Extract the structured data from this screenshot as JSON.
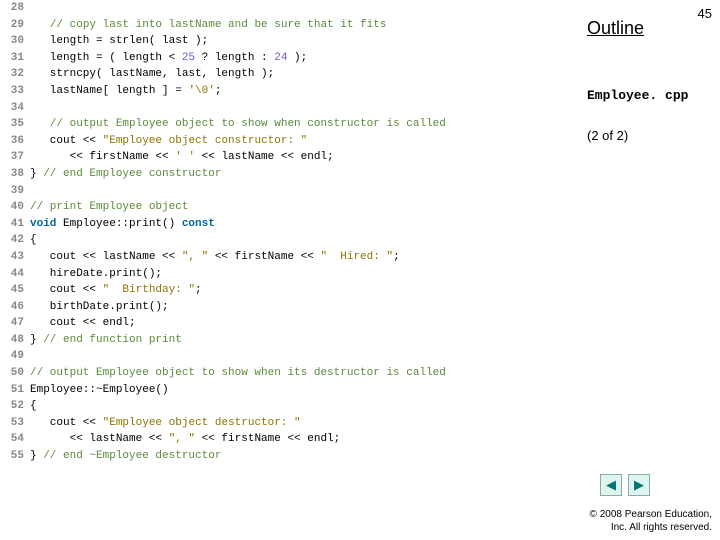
{
  "page_number": "45",
  "outline_label": "Outline",
  "filename": "Employee. cpp",
  "part_info": "(2 of 2)",
  "copyright_line1": "© 2008 Pearson Education,",
  "copyright_line2": "Inc.  All rights reserved.",
  "nav": {
    "prev_glyph": "◀",
    "next_glyph": "▶"
  },
  "code": [
    {
      "n": "28",
      "t": []
    },
    {
      "n": "29",
      "t": [
        [
          "   ",
          "p"
        ],
        [
          "// copy last into lastName and be sure that it fits",
          "comment"
        ]
      ]
    },
    {
      "n": "30",
      "t": [
        [
          "   length = strlen( last );",
          "p"
        ]
      ]
    },
    {
      "n": "31",
      "t": [
        [
          "   length = ( length < ",
          "p"
        ],
        [
          "25",
          "num"
        ],
        [
          " ? length : ",
          "p"
        ],
        [
          "24",
          "num"
        ],
        [
          " );",
          "p"
        ]
      ]
    },
    {
      "n": "32",
      "t": [
        [
          "   strncpy( lastName, last, length );",
          "p"
        ]
      ]
    },
    {
      "n": "33",
      "t": [
        [
          "   lastName[ length ] = ",
          "p"
        ],
        [
          "'\\0'",
          "char"
        ],
        [
          ";",
          "p"
        ]
      ]
    },
    {
      "n": "34",
      "t": []
    },
    {
      "n": "35",
      "t": [
        [
          "   ",
          "p"
        ],
        [
          "// output Employee object to show when constructor is called",
          "comment"
        ]
      ]
    },
    {
      "n": "36",
      "t": [
        [
          "   cout << ",
          "p"
        ],
        [
          "\"Employee object constructor: \"",
          "str"
        ]
      ]
    },
    {
      "n": "37",
      "t": [
        [
          "      << firstName << ",
          "p"
        ],
        [
          "' '",
          "char"
        ],
        [
          " << lastName << endl;",
          "p"
        ]
      ]
    },
    {
      "n": "38",
      "t": [
        [
          "} ",
          "p"
        ],
        [
          "// end Employee constructor",
          "comment"
        ]
      ]
    },
    {
      "n": "39",
      "t": []
    },
    {
      "n": "40",
      "t": [
        [
          "// print Employee object",
          "comment"
        ]
      ]
    },
    {
      "n": "41",
      "t": [
        [
          "void",
          "kw"
        ],
        [
          " Employee::print() ",
          "p"
        ],
        [
          "const",
          "kw"
        ]
      ]
    },
    {
      "n": "42",
      "t": [
        [
          "{",
          "p"
        ]
      ]
    },
    {
      "n": "43",
      "t": [
        [
          "   cout << lastName << ",
          "p"
        ],
        [
          "\", \"",
          "str"
        ],
        [
          " << firstName << ",
          "p"
        ],
        [
          "\"  Hired: \"",
          "str"
        ],
        [
          ";",
          "p"
        ]
      ]
    },
    {
      "n": "44",
      "t": [
        [
          "   hireDate.print();",
          "p"
        ]
      ]
    },
    {
      "n": "45",
      "t": [
        [
          "   cout << ",
          "p"
        ],
        [
          "\"  Birthday: \"",
          "str"
        ],
        [
          ";",
          "p"
        ]
      ]
    },
    {
      "n": "46",
      "t": [
        [
          "   birthDate.print();",
          "p"
        ]
      ]
    },
    {
      "n": "47",
      "t": [
        [
          "   cout << endl;",
          "p"
        ]
      ]
    },
    {
      "n": "48",
      "t": [
        [
          "} ",
          "p"
        ],
        [
          "// end function print",
          "comment"
        ]
      ]
    },
    {
      "n": "49",
      "t": []
    },
    {
      "n": "50",
      "t": [
        [
          "// output Employee object to show when its destructor is called",
          "comment"
        ]
      ]
    },
    {
      "n": "51",
      "t": [
        [
          "Employee::~Employee()",
          "p"
        ]
      ]
    },
    {
      "n": "52",
      "t": [
        [
          "{",
          "p"
        ]
      ]
    },
    {
      "n": "53",
      "t": [
        [
          "   cout << ",
          "p"
        ],
        [
          "\"Employee object destructor: \"",
          "str"
        ]
      ]
    },
    {
      "n": "54",
      "t": [
        [
          "      << lastName << ",
          "p"
        ],
        [
          "\", \"",
          "str"
        ],
        [
          " << firstName << endl;",
          "p"
        ]
      ]
    },
    {
      "n": "55",
      "t": [
        [
          "} ",
          "p"
        ],
        [
          "// end ~Employee destructor",
          "comment"
        ]
      ]
    }
  ]
}
